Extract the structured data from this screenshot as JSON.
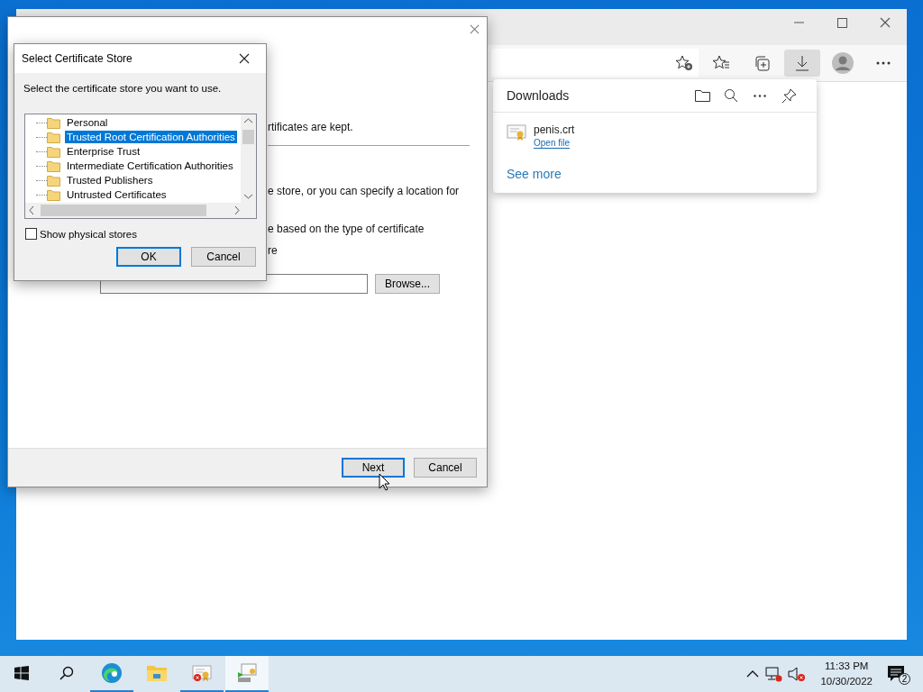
{
  "downloads": {
    "title": "Downloads",
    "items": [
      {
        "name": "penis.crt",
        "action": "Open file"
      }
    ],
    "see_more": "See more"
  },
  "wizard": {
    "texts": [
      "rtificates are kept.",
      "e store, or you can specify a location for",
      "e based on the type of certificate",
      "re"
    ],
    "browse": "Browse...",
    "buttons": [
      {
        "label": "Next",
        "selected": true
      },
      {
        "label": "Cancel",
        "selected": false
      }
    ]
  },
  "store_dialog": {
    "title": "Select Certificate Store",
    "prompt": "Select the certificate store you want to use.",
    "stores": [
      {
        "label": "Personal",
        "selected": false
      },
      {
        "label": "Trusted Root Certification Authorities",
        "selected": true
      },
      {
        "label": "Enterprise Trust",
        "selected": false
      },
      {
        "label": "Intermediate Certification Authorities",
        "selected": false
      },
      {
        "label": "Trusted Publishers",
        "selected": false
      },
      {
        "label": "Untrusted Certificates",
        "selected": false
      }
    ],
    "show_physical": {
      "label": "Show physical stores",
      "checked": false
    },
    "buttons": [
      {
        "label": "OK",
        "selected": true
      },
      {
        "label": "Cancel",
        "selected": false
      }
    ]
  },
  "taskbar": {
    "apps": [
      {
        "kind": "edge",
        "running": true,
        "selected": false
      },
      {
        "kind": "explorer",
        "running": false,
        "selected": false
      },
      {
        "kind": "cert-error",
        "running": true,
        "selected": false
      },
      {
        "kind": "cert-import",
        "running": true,
        "selected": true
      }
    ],
    "time": "11:33 PM",
    "date": "10/30/2022",
    "notifications": "2"
  }
}
